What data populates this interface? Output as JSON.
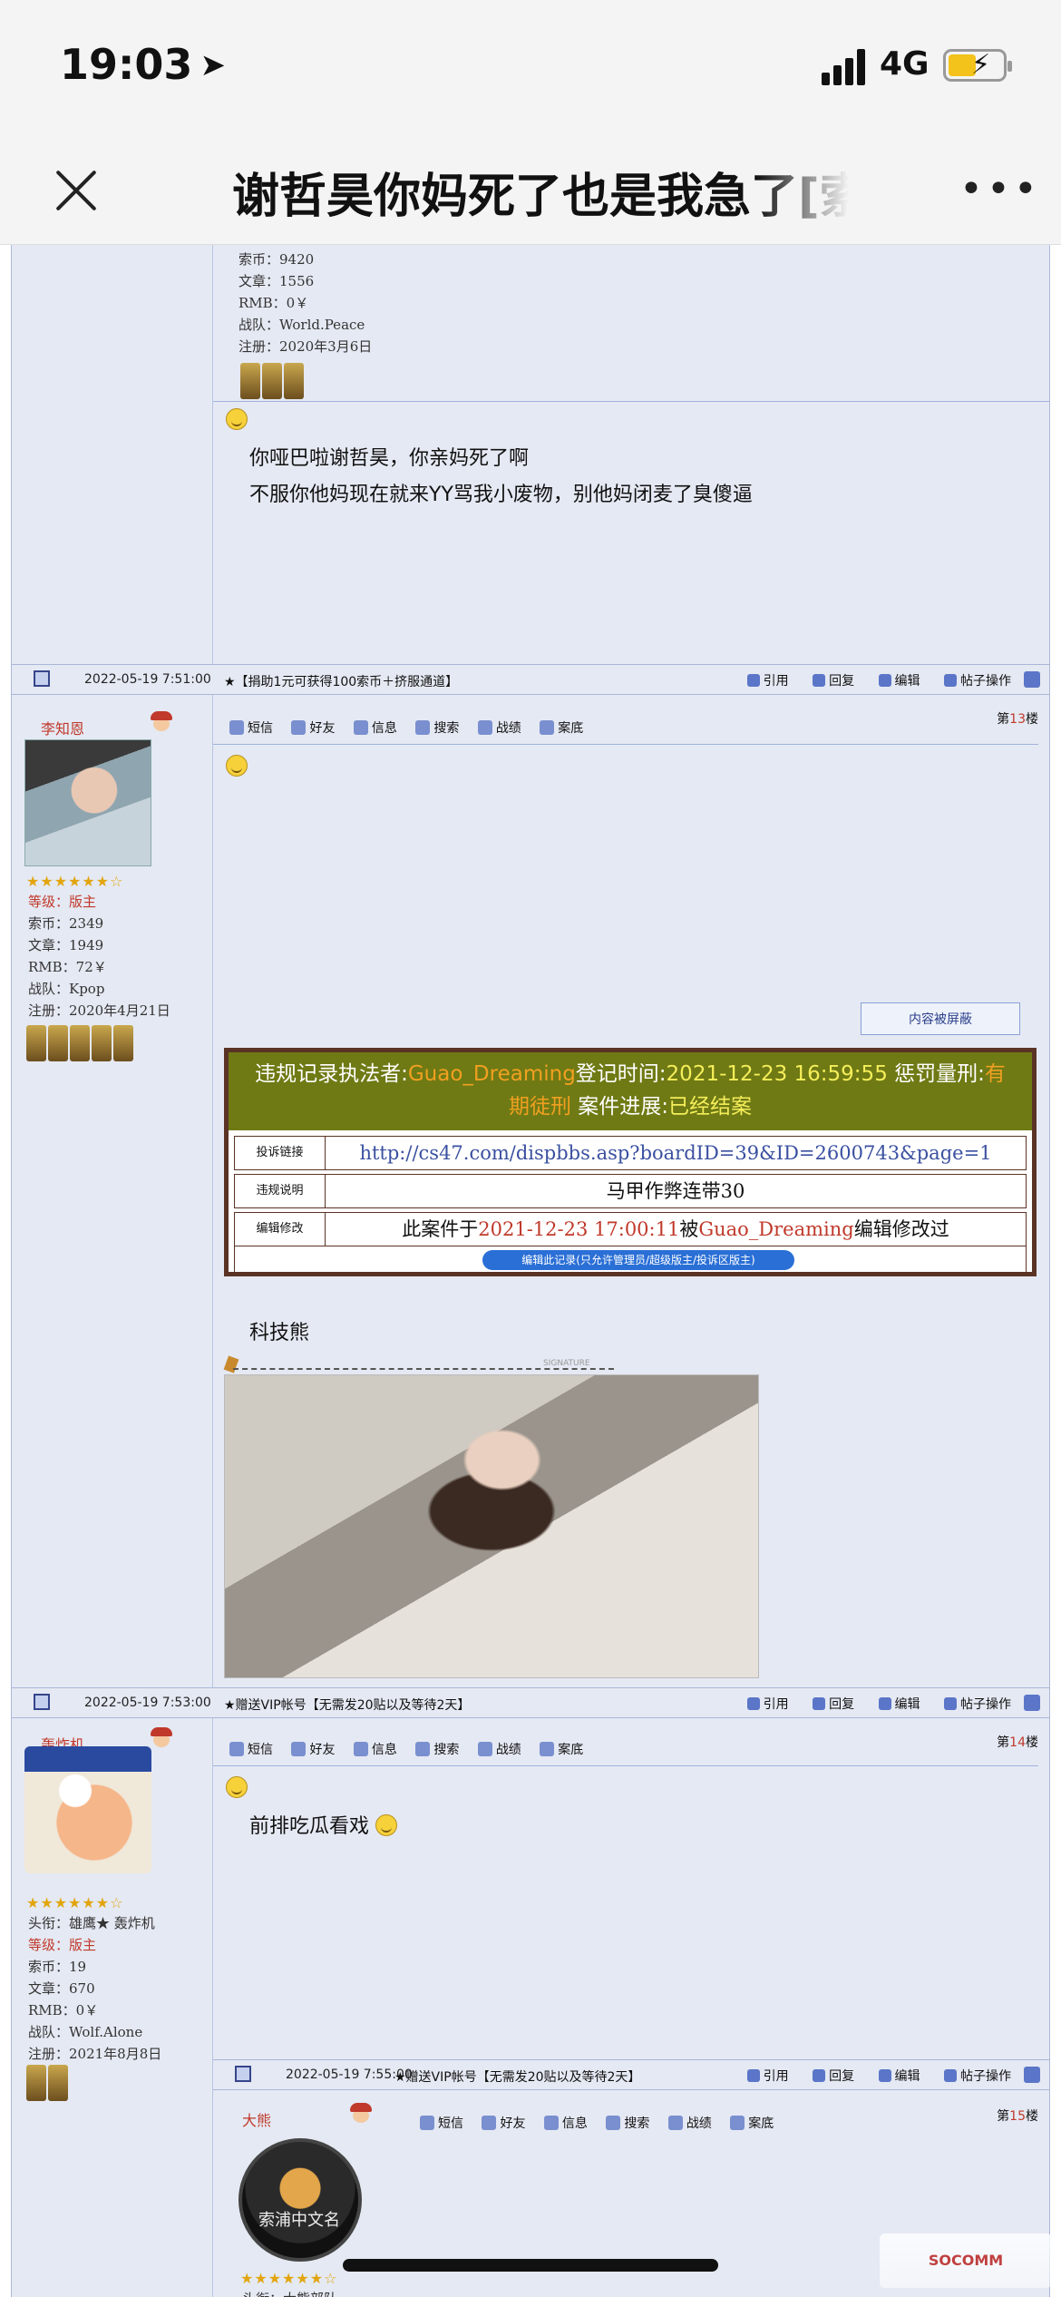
{
  "status_bar": {
    "time": "19:03",
    "network": "4G"
  },
  "header": {
    "title": "谢哲昊你妈死了也是我急了[索"
  },
  "post12": {
    "user_stats": [
      "索币：9420",
      "文章：1556",
      "RMB：0￥",
      "战队：World.Peace",
      "注册：2020年3月6日"
    ],
    "lines": [
      "你哑巴啦谢哲昊，你亲妈死了啊",
      "不服你他妈现在就来YY骂我小废物，别他妈闭麦了臭傻逼"
    ]
  },
  "bar13": {
    "date": "2022-05-19 7:51:00",
    "ad": "★【捐助1元可获得100索币＋挤服通道】"
  },
  "post13": {
    "username": "李知恩",
    "level": "等级：版主",
    "stats": [
      "索币：2349",
      "文章：1949",
      "RMB：72￥",
      "战队：Kpop",
      "注册：2020年4月21日"
    ],
    "floor_prefix": "第",
    "floor_num": "13",
    "floor_suffix": "楼",
    "blocked": "内容被屏蔽",
    "violation": {
      "executor_label": "违规记录执法者:",
      "executor": "Guao_Dreaming",
      "time_label": "登记时间:",
      "time": "2021-12-23 16:59:55",
      "penalty_label": " 惩罚量刑:",
      "penalty": "有期徒刑",
      "case_label": " 案件进展:",
      "case": "已经结案",
      "row1_key": "投诉链接",
      "row1_val": "http://cs47.com/dispbbs.asp?boardID=39&ID=2600743&page=1",
      "row2_key": "违规说明",
      "row2_val": "马甲作弊连带30",
      "row3_key": "编辑修改",
      "row3_pre": "此案件于",
      "row3_time": "2021-12-23 17:00:11",
      "row3_mid": "被",
      "row3_name": "Guao_Dreaming",
      "row3_post": "编辑修改过",
      "edit_button": "编辑此记录(只允许管理员/超级版主/投诉区版主)"
    },
    "sign": "科技熊",
    "sig_label": "SIGNATURE"
  },
  "bar14": {
    "date": "2022-05-19 7:53:00",
    "ad": "★赠送VIP帐号【无需发20贴以及等待2天】"
  },
  "post14": {
    "username": "轰炸机",
    "title": "头衔：雄鹰★ 轰炸机",
    "level": "等级：版主",
    "stats": [
      "索币：19",
      "文章：670",
      "RMB：0￥",
      "战队：Wolf.Alone",
      "注册：2021年8月8日"
    ],
    "floor_prefix": "第",
    "floor_num": "14",
    "floor_suffix": "楼",
    "text": "前排吃瓜看戏"
  },
  "bar15": {
    "date": "2022-05-19 7:55:00",
    "ad": "★赠送VIP帐号【无需发20贴以及等待2天】"
  },
  "post15": {
    "username": "大熊",
    "floor_prefix": "第",
    "floor_num": "15",
    "floor_suffix": "楼",
    "avatar_text": "索浦中文名",
    "title_partial": "头衔：大熊部队"
  },
  "toolbar": [
    "短信",
    "好友",
    "信息",
    "搜索",
    "战绩",
    "案底"
  ],
  "actions": [
    "引用",
    "回复",
    "编辑",
    "帖子操作"
  ],
  "stars": "★★★★★★☆"
}
